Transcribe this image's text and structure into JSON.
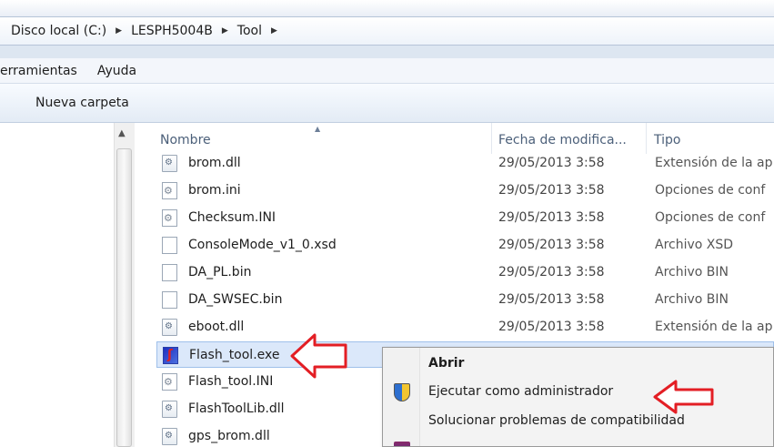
{
  "address": {
    "crumbs": [
      "Disco local (C:)",
      "LESPH5004B",
      "Tool"
    ]
  },
  "menu": {
    "items": [
      "erramientas",
      "Ayuda"
    ]
  },
  "toolbar": {
    "new_folder": "Nueva carpeta"
  },
  "columns": {
    "name": "Nombre",
    "date": "Fecha de modifica...",
    "type": "Tipo"
  },
  "files": [
    {
      "name": "brom.dll",
      "date": "29/05/2013 3:58",
      "type": "Extensión de la ap",
      "icon": "dll-file-icon"
    },
    {
      "name": "brom.ini",
      "date": "29/05/2013 3:58",
      "type": "Opciones de conf",
      "icon": "ini-file-icon"
    },
    {
      "name": "Checksum.INI",
      "date": "29/05/2013 3:58",
      "type": "Opciones de conf",
      "icon": "ini-file-icon"
    },
    {
      "name": "ConsoleMode_v1_0.xsd",
      "date": "29/05/2013 3:58",
      "type": "Archivo XSD",
      "icon": "blank-file-icon"
    },
    {
      "name": "DA_PL.bin",
      "date": "29/05/2013 3:58",
      "type": "Archivo BIN",
      "icon": "blank-file-icon"
    },
    {
      "name": "DA_SWSEC.bin",
      "date": "29/05/2013 3:58",
      "type": "Archivo BIN",
      "icon": "blank-file-icon"
    },
    {
      "name": "eboot.dll",
      "date": "29/05/2013 3:58",
      "type": "Extensión de la ap",
      "icon": "dll-file-icon"
    },
    {
      "name": "Flash_tool.exe",
      "date": "",
      "type": "",
      "icon": "exe-file-icon"
    },
    {
      "name": "Flash_tool.INI",
      "date": "",
      "type": "",
      "icon": "ini-file-icon"
    },
    {
      "name": "FlashToolLib.dll",
      "date": "",
      "type": "",
      "icon": "dll-file-icon"
    },
    {
      "name": "gps_brom.dll",
      "date": "",
      "type": "",
      "icon": "dll-file-icon"
    }
  ],
  "context_menu": {
    "open": "Abrir",
    "run_as_admin": "Ejecutar como administrador",
    "troubleshoot": "Solucionar problemas de compatibilidad"
  },
  "colors": {
    "selection": "#dbe8fa",
    "annotation_arrow": "#e31e24"
  }
}
